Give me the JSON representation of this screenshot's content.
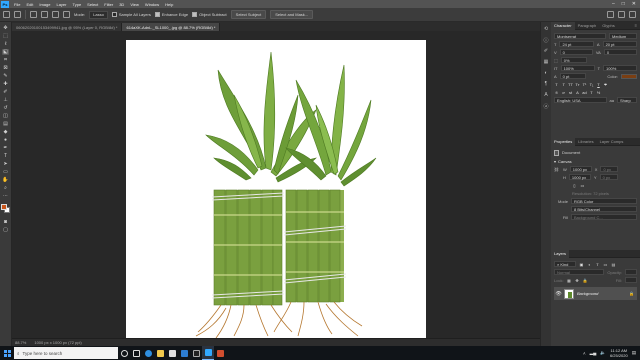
{
  "app": {
    "logo": "Ps"
  },
  "menu": [
    "File",
    "Edit",
    "Image",
    "Layer",
    "Type",
    "Select",
    "Filter",
    "3D",
    "View",
    "Window",
    "Help"
  ],
  "window_controls": [
    "–",
    "□",
    "✕"
  ],
  "options": {
    "mode_label": "Mode:",
    "mode_value": "Lasso",
    "sample_all_layers": "Sample All Layers",
    "enhance_edge": "Enhance Edge",
    "object_subtract": "Object Subtract",
    "select_subject": "Select Subject",
    "select_and_mask": "Select and Mask..."
  },
  "tabs": [
    {
      "label": "06062020100153499941.jpg @ 95% (Layer 0, RGB/8#) *",
      "active": false
    },
    {
      "label": "614aXK-AdnL._SL1000_.jpg @ 88.7% (RGB/8#) *",
      "active": true
    }
  ],
  "status": {
    "zoom": "88.7%",
    "doc_info": "1000 px x 1000 px (72 ppi)"
  },
  "character_panel": {
    "tabs": [
      "Character",
      "Paragraph",
      "Glyphs"
    ],
    "font_family": "Montserrat",
    "font_style": "Medium",
    "font_size": "24 pt",
    "leading": "20 pt",
    "kerning": "0",
    "tracking": "0%",
    "vertical_scale": "100%",
    "horizontal_scale": "100%",
    "baseline": "0 pt",
    "color_label": "Color:",
    "color_value": "#7a3e12",
    "language": "English: USA",
    "antialias": "Sharp"
  },
  "properties_panel": {
    "tabs": [
      "Properties",
      "Libraries",
      "Layer Comps"
    ],
    "document_label": "Document",
    "canvas_label": "Canvas",
    "w_label": "W",
    "w_value": "1000 px",
    "h_label": "H",
    "h_value": "1000 px",
    "x_label": "X",
    "x_value": "0 px",
    "y_label": "Y",
    "y_value": "0 px",
    "resolution": "Resolution: 72 pixels",
    "mode_label": "Mode",
    "mode_value": "RGB Color",
    "depth_value": "8 Bits/Channel",
    "fill_label": "Fill",
    "fill_value": "Background C..."
  },
  "layers_panel": {
    "tab": "Layers",
    "kind_label": "Kind",
    "blend_mode": "Normal",
    "opacity_label": "Opacity:",
    "lock_label": "Lock:",
    "fill_label": "Fill:",
    "layers": [
      {
        "name": "Background"
      }
    ]
  },
  "taskbar": {
    "search_placeholder": "Type here to search",
    "time": "11:12 AM",
    "date": "6/25/2020"
  }
}
